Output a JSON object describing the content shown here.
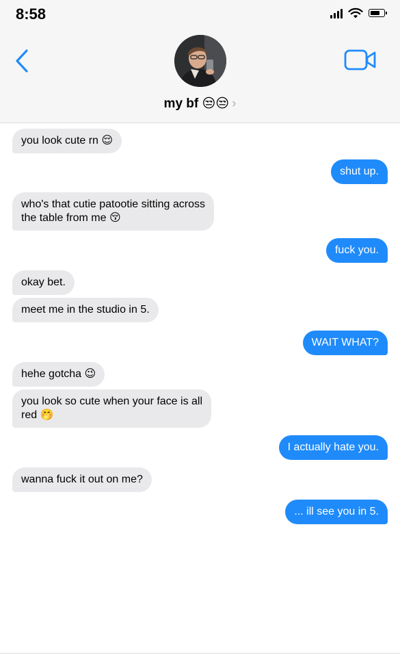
{
  "status_bar": {
    "time": "8:58"
  },
  "header": {
    "contact_name": "my bf 😒😒",
    "chevron": "›",
    "icons": {
      "back": "chevron-left-icon",
      "video": "video-camera-icon"
    },
    "accent_color": "#1f8bfa"
  },
  "messages": [
    {
      "side": "in",
      "text": "you look cute rn 😌"
    },
    {
      "side": "out",
      "text": "shut up."
    },
    {
      "side": "in",
      "text": "who's that cutie patootie sitting across\nthe table from me 😚"
    },
    {
      "side": "out",
      "text": "fuck you."
    },
    {
      "side": "in",
      "text": "okay bet."
    },
    {
      "side": "in",
      "text": "meet me in the studio in 5."
    },
    {
      "side": "out",
      "text": "WAIT WHAT?"
    },
    {
      "side": "in",
      "text": "hehe gotcha 😉"
    },
    {
      "side": "in",
      "text": "you look so cute when your face is all\nred 🤭"
    },
    {
      "side": "out",
      "text": "I actually hate you."
    },
    {
      "side": "in",
      "text": "wanna fuck it out on me?"
    },
    {
      "side": "out",
      "text": "... ill see you in 5."
    }
  ]
}
